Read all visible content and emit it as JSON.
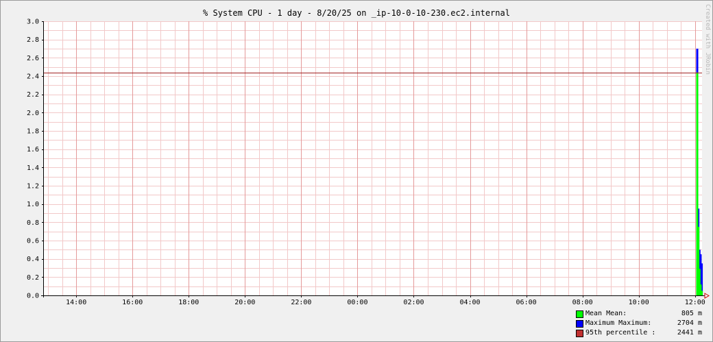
{
  "chart_data": {
    "type": "area",
    "title": "% System CPU - 1 day - 8/20/25 on _ip-10-0-10-230.ec2.internal",
    "watermark": "Created with JRobin",
    "x_tick_labels": [
      "14:00",
      "16:00",
      "18:00",
      "20:00",
      "22:00",
      "00:00",
      "02:00",
      "04:00",
      "06:00",
      "08:00",
      "10:00",
      "12:00"
    ],
    "x_tick_hours": [
      14,
      16,
      18,
      20,
      22,
      24,
      26,
      28,
      30,
      32,
      34,
      36
    ],
    "xlim_hours": [
      12.85,
      36.25
    ],
    "y_tick_labels": [
      "0.0",
      "0.2",
      "0.4",
      "0.6",
      "0.8",
      "1.0",
      "1.2",
      "1.4",
      "1.6",
      "1.8",
      "2.0",
      "2.2",
      "2.4",
      "2.6",
      "2.8",
      "3.0"
    ],
    "ylim": [
      0,
      3.0
    ],
    "grid": true,
    "series": [
      {
        "name": "Mean",
        "color": "#00ff00",
        "points": [
          {
            "x": 36.08,
            "y": 2.44
          },
          {
            "x": 36.12,
            "y": 0.75
          },
          {
            "x": 36.16,
            "y": 0.29
          },
          {
            "x": 36.2,
            "y": 0.12
          },
          {
            "x": 36.24,
            "y": 0.05
          }
        ]
      },
      {
        "name": "Maximum",
        "color": "#0000ff",
        "points": [
          {
            "x": 36.08,
            "y": 2.7
          },
          {
            "x": 36.12,
            "y": 0.95
          },
          {
            "x": 36.16,
            "y": 0.5
          },
          {
            "x": 36.2,
            "y": 0.45
          },
          {
            "x": 36.24,
            "y": 0.35
          }
        ]
      }
    ],
    "percentile_line": {
      "name": "95th percentile",
      "value": 2.441,
      "color": "#a02020"
    },
    "legend": [
      {
        "label": "Mean  Mean:",
        "value": "805 m",
        "color": "#00ff00"
      },
      {
        "label": "Maximum  Maximum:",
        "value": "2704 m",
        "color": "#0000ff"
      },
      {
        "label": "95th percentile  :",
        "value": "2441 m",
        "color": "#c03030"
      }
    ]
  }
}
